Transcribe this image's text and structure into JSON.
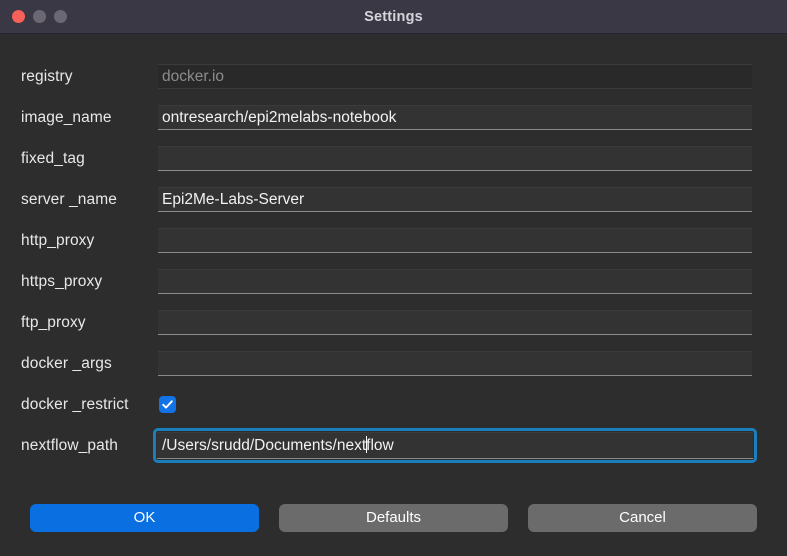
{
  "window": {
    "title": "Settings",
    "traffic_lights": [
      {
        "name": "close",
        "color": "#f8605a"
      },
      {
        "name": "minimize",
        "color": "#6b6873"
      },
      {
        "name": "maximize",
        "color": "#6b6873"
      }
    ]
  },
  "theme": {
    "titlebar_bg": "#3b3846",
    "body_bg": "#2d2d2d",
    "field_bg": "#333333",
    "field_disabled_bg": "#292929",
    "accent_blue": "#0a6fe0",
    "focus_ring": "#1a7fba",
    "checkbox_blue": "#1273e6",
    "text": "#e8e8e8",
    "placeholder_text": "#8d8d8d"
  },
  "fields": [
    {
      "name": "registry",
      "label": "registry",
      "type": "text",
      "value": "",
      "placeholder": "docker.io",
      "disabled": true,
      "focused": false
    },
    {
      "name": "image_name",
      "label": "image_name",
      "type": "text",
      "value": "ontresearch/epi2melabs-notebook",
      "placeholder": "",
      "disabled": false,
      "focused": false
    },
    {
      "name": "fixed_tag",
      "label": "fixed_tag",
      "type": "text",
      "value": "",
      "placeholder": "",
      "disabled": false,
      "focused": false
    },
    {
      "name": "server_name",
      "label": "server _name",
      "type": "text",
      "value": "Epi2Me-Labs-Server",
      "placeholder": "",
      "disabled": false,
      "focused": false
    },
    {
      "name": "http_proxy",
      "label": "http_proxy",
      "type": "text",
      "value": "",
      "placeholder": "",
      "disabled": false,
      "focused": false
    },
    {
      "name": "https_proxy",
      "label": "https_proxy",
      "type": "text",
      "value": "",
      "placeholder": "",
      "disabled": false,
      "focused": false
    },
    {
      "name": "ftp_proxy",
      "label": "ftp_proxy",
      "type": "text",
      "value": "",
      "placeholder": "",
      "disabled": false,
      "focused": false
    },
    {
      "name": "docker_args",
      "label": "docker _args",
      "type": "text",
      "value": "",
      "placeholder": "",
      "disabled": false,
      "focused": false
    },
    {
      "name": "docker_restrict",
      "label": "docker _restrict",
      "type": "checkbox",
      "checked": true,
      "icon": "check-icon"
    },
    {
      "name": "nextflow_path",
      "label": "nextflow_path",
      "type": "text",
      "value": "/Users/srudd/Documents/nextflow",
      "value_before_caret": "/Users/srudd/Documents/next",
      "value_after_caret": "flow",
      "placeholder": "",
      "disabled": false,
      "focused": true
    }
  ],
  "buttons": [
    {
      "name": "ok",
      "label": "OK",
      "style": "primary"
    },
    {
      "name": "defaults",
      "label": "Defaults",
      "style": "default"
    },
    {
      "name": "cancel",
      "label": "Cancel",
      "style": "default"
    }
  ]
}
